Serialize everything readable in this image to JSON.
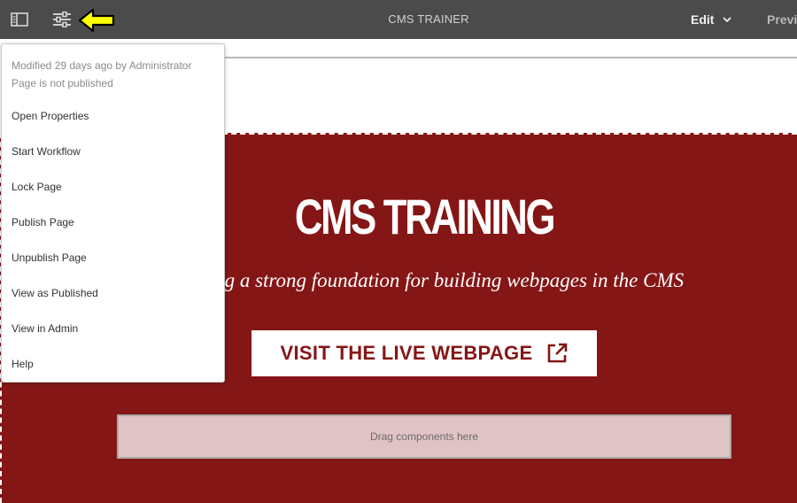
{
  "toolbar": {
    "title": "CMS TRAINER",
    "mode_label": "Edit",
    "preview_label": "Preview",
    "icons": {
      "side_panel": "side-panel-icon",
      "page_information": "page-information-sliders-icon",
      "mode_dropdown": "chevron-down-icon"
    }
  },
  "annotation": {
    "arrow_color": "#ffff00",
    "arrow_icon": "left-arrow-icon"
  },
  "page_info_menu": {
    "modified_text": "Modified 29 days ago by Administrator",
    "publish_status": "Page is not published",
    "items": [
      "Open Properties",
      "Start Workflow",
      "Lock Page",
      "Publish Page",
      "Unpublish Page",
      "View as Published",
      "View in Admin",
      "Help"
    ]
  },
  "hero": {
    "title": "CMS TRAINING",
    "subtitle": "Building a strong foundation for building webpages in the CMS",
    "cta_label": "VISIT THE LIVE WEBPAGE",
    "cta_icon": "external-link-icon",
    "background_color": "#851616"
  },
  "drop_zone": {
    "label": "Drag components here"
  }
}
